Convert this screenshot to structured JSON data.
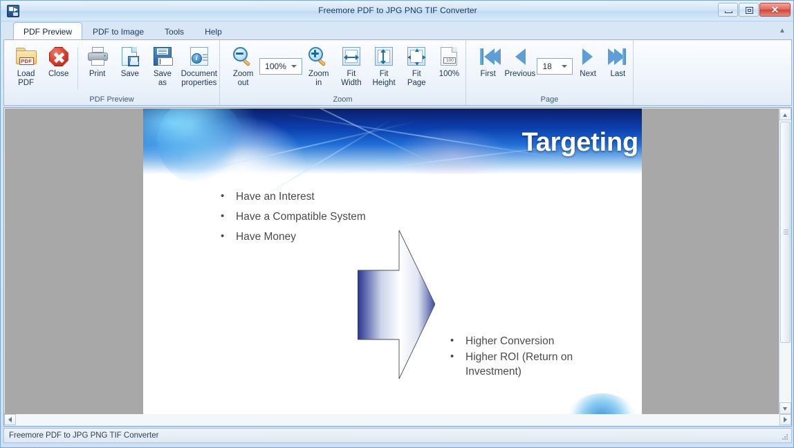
{
  "window": {
    "title": "Freemore PDF to JPG PNG TIF Converter",
    "app_icon": "app-convert-icon",
    "controls": {
      "minimize": "minimize-button",
      "maximize": "maximize-button",
      "close": "close-button",
      "close_glyph": "✕"
    }
  },
  "ribbon": {
    "collapse_glyph": "▲",
    "tabs": [
      {
        "label": "PDF Preview",
        "active": true
      },
      {
        "label": "PDF to Image",
        "active": false
      },
      {
        "label": "Tools",
        "active": false
      },
      {
        "label": "Help",
        "active": false
      }
    ],
    "groups": [
      {
        "label": "PDF Preview",
        "items": [
          {
            "label_line1": "Load",
            "label_line2": "PDF",
            "icon": "load-pdf-icon"
          },
          {
            "label_line1": "Close",
            "label_line2": "",
            "icon": "close-pdf-icon"
          },
          {
            "label_line1": "Print",
            "label_line2": "",
            "icon": "printer-icon"
          },
          {
            "label_line1": "Save",
            "label_line2": "",
            "icon": "save-icon"
          },
          {
            "label_line1": "Save",
            "label_line2": "as",
            "icon": "save-as-icon"
          },
          {
            "label_line1": "Document",
            "label_line2": "properties",
            "icon": "document-properties-icon"
          }
        ]
      },
      {
        "label": "Zoom",
        "items": [
          {
            "label_line1": "Zoom",
            "label_line2": "out",
            "icon": "zoom-out-icon"
          },
          {
            "label_line1": "Zoom",
            "label_line2": "in",
            "icon": "zoom-in-icon"
          },
          {
            "label_line1": "Fit",
            "label_line2": "Width",
            "icon": "fit-width-icon"
          },
          {
            "label_line1": "Fit",
            "label_line2": "Height",
            "icon": "fit-height-icon"
          },
          {
            "label_line1": "Fit",
            "label_line2": "Page",
            "icon": "fit-page-icon"
          },
          {
            "label_line1": "100%",
            "label_line2": "",
            "icon": "actual-size-icon"
          }
        ],
        "zoom_combo": {
          "value": "100%",
          "caret": "chevron-down-icon"
        }
      },
      {
        "label": "Page",
        "items": [
          {
            "label_line1": "First",
            "label_line2": "",
            "icon": "first-page-icon"
          },
          {
            "label_line1": "Previous",
            "label_line2": "",
            "icon": "previous-page-icon"
          },
          {
            "label_line1": "Next",
            "label_line2": "",
            "icon": "next-page-icon"
          },
          {
            "label_line1": "Last",
            "label_line2": "",
            "icon": "last-page-icon"
          }
        ],
        "page_combo": {
          "value": "18",
          "caret": "chevron-down-icon"
        }
      }
    ]
  },
  "preview": {
    "slide": {
      "title": "Targeting",
      "bullets_top": [
        "Have an Interest",
        "Have a Compatible System",
        "Have Money"
      ],
      "bullets_bottom": [
        "Higher Conversion",
        "Higher ROI (Return on Investment)"
      ],
      "arrow_shape": "right-arrow-shape"
    },
    "scroll": {
      "v_up": "scroll-up-arrow",
      "v_down": "scroll-down-arrow",
      "h_left": "scroll-left-arrow",
      "h_right": "scroll-right-arrow"
    }
  },
  "statusbar": {
    "text": "Freemore PDF to JPG PNG TIF Converter"
  },
  "colors": {
    "accent": "#1f6fb2",
    "title_blue": "#16335c",
    "close_red": "#cf4436",
    "slide_header_dark": "#050f48",
    "slide_header_light": "#1790ff",
    "canvas_gray": "#a8a8a8"
  }
}
